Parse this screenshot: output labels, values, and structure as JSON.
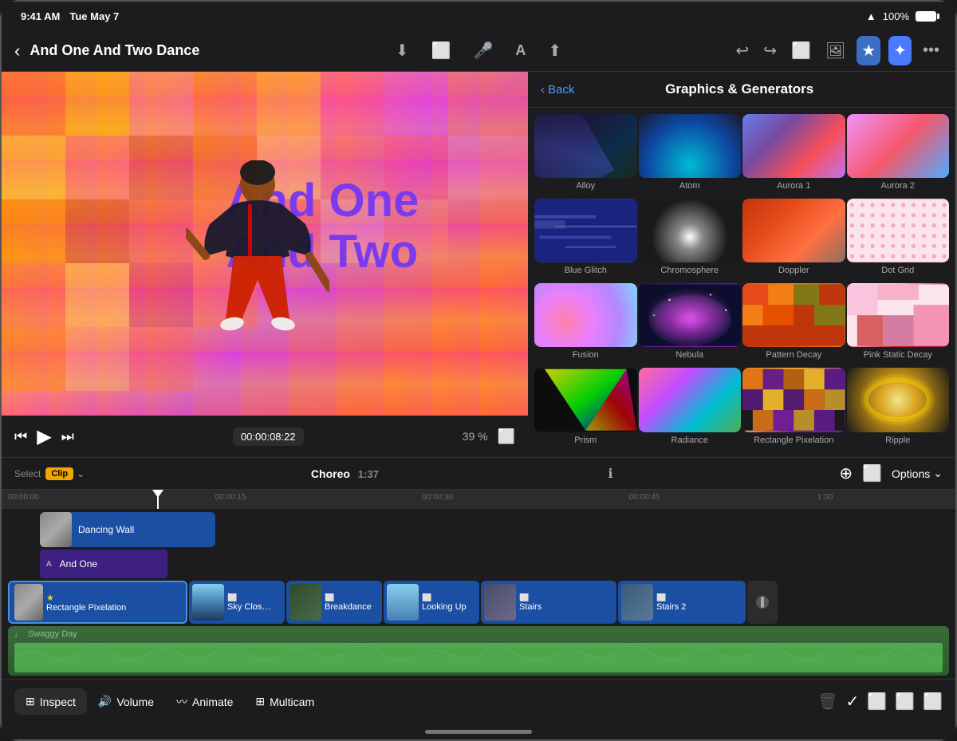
{
  "statusBar": {
    "time": "9:41 AM",
    "date": "Tue May 7",
    "wifi": "WiFi",
    "battery": "100%"
  },
  "toolbar": {
    "backLabel": "‹",
    "projectTitle": "And One And Two Dance",
    "downloadIcon": "⬇",
    "cameraIcon": "📷",
    "micIcon": "🎤",
    "textIcon": "A",
    "shareIcon": "⬆",
    "undoIcon": "↩",
    "redoIcon": "↪",
    "captionsIcon": "≡",
    "photoIcon": "🖼",
    "starIcon": "★",
    "magicIcon": "✦",
    "moreIcon": "•••"
  },
  "videoPlayer": {
    "titleLine1": "And One",
    "titleLine2": "And Two",
    "currentTime": "00:00:08:22",
    "zoomLevel": "39 %"
  },
  "graphicsPanel": {
    "backLabel": "Back",
    "title": "Graphics & Generators",
    "items": [
      {
        "id": "alloy",
        "label": "Alloy"
      },
      {
        "id": "atom",
        "label": "Atom"
      },
      {
        "id": "aurora1",
        "label": "Aurora 1"
      },
      {
        "id": "aurora2",
        "label": "Aurora 2"
      },
      {
        "id": "blueglitch",
        "label": "Blue Glitch"
      },
      {
        "id": "chromosphere",
        "label": "Chromosphere"
      },
      {
        "id": "doppler",
        "label": "Doppler"
      },
      {
        "id": "dotgrid",
        "label": "Dot Grid"
      },
      {
        "id": "fusion",
        "label": "Fusion"
      },
      {
        "id": "nebula",
        "label": "Nebula"
      },
      {
        "id": "patterndecay",
        "label": "Pattern Decay"
      },
      {
        "id": "pinkstatic",
        "label": "Pink Static Decay"
      },
      {
        "id": "prism",
        "label": "Prism"
      },
      {
        "id": "radiance",
        "label": "Radiance"
      },
      {
        "id": "rectpixel",
        "label": "Rectangle Pixelation"
      },
      {
        "id": "ripple",
        "label": "Ripple"
      }
    ]
  },
  "timeline": {
    "selectLabel": "Select",
    "clipLabel": "Clip",
    "choreoTitle": "Choreo",
    "choreoDuration": "1:37",
    "optionsLabel": "Options",
    "rulerMarks": [
      "00:00:00",
      "00:00:15",
      "00:00:30",
      "00:00:45",
      "1:00"
    ],
    "clips": {
      "dancingWall": "Dancing Wall",
      "andOne": "And One",
      "rectPixelation": "Rectangle Pixelation",
      "skyClose": "Sky Close-...",
      "breakdance": "Breakdance",
      "lookingUp": "Looking Up",
      "stairs": "Stairs",
      "stairs2": "Stairs 2",
      "swaggyDay": "Swaggy Day"
    }
  },
  "bottomToolbar": {
    "inspectLabel": "Inspect",
    "volumeLabel": "Volume",
    "animateLabel": "Animate",
    "multicamLabel": "Multicam"
  }
}
